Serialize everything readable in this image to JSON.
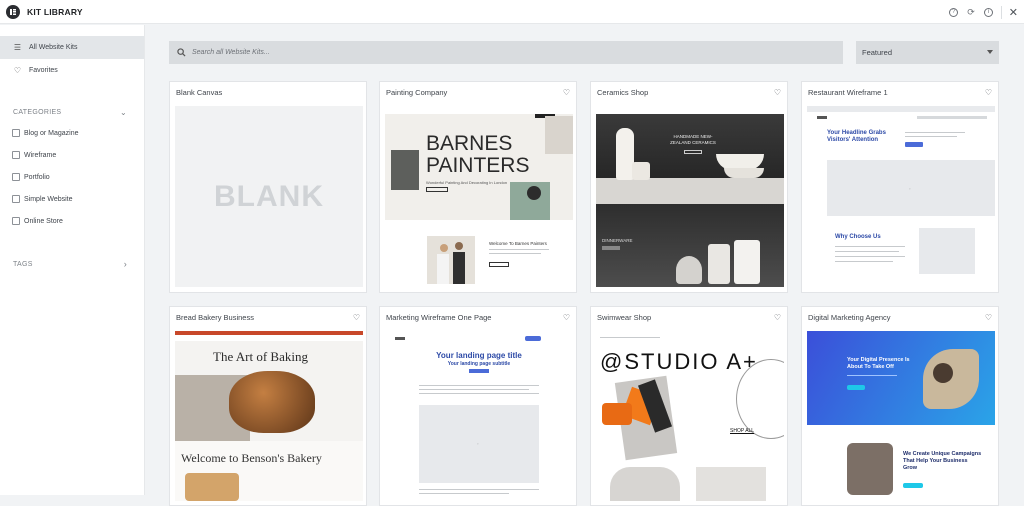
{
  "header": {
    "title": "KIT LIBRARY"
  },
  "sidebar": {
    "all_kits": "All Website Kits",
    "favorites": "Favorites",
    "categories_label": "CATEGORIES",
    "categories": [
      "Blog or Magazine",
      "Wireframe",
      "Portfolio",
      "Simple Website",
      "Online Store"
    ],
    "tags_label": "TAGS"
  },
  "search": {
    "placeholder": "Search all Website Kits..."
  },
  "sort": {
    "selected": "Featured"
  },
  "kits": [
    {
      "name": "Blank Canvas",
      "thumb_text": "BLANK"
    },
    {
      "name": "Painting Company",
      "headline": "BARNES PAINTERS",
      "sub": "Wonderful Painting And Decorating In London",
      "welcome": "Welcome To Barnes Painters"
    },
    {
      "name": "Ceramics Shop",
      "headline": "HANDMADE NEW-ZEALAND CERAMICS",
      "label": "DINNERWARE"
    },
    {
      "name": "Restaurant Wireframe 1",
      "headline": "Your Headline Grabs Visitors' Attention",
      "section": "Why Choose Us"
    },
    {
      "name": "Bread Bakery Business",
      "headline": "The Art of Baking",
      "welcome": "Welcome to Benson's Bakery"
    },
    {
      "name": "Marketing Wireframe One Page",
      "headline": "Your landing page title",
      "sub": "Your landing page subtitle"
    },
    {
      "name": "Swimwear Shop",
      "headline": "@STUDIO A+",
      "link": "SHOP ALL"
    },
    {
      "name": "Digital Marketing Agency",
      "headline": "Your Digital Presence Is About To Take Off",
      "sub": "We Create Unique Campaigns That Help Your Business Grow"
    }
  ],
  "colors": {
    "accent": "#2b2d31",
    "wire_button": "#4b6bd8",
    "bakery_red": "#c8482a",
    "agency_blue": "#3b4fd9"
  }
}
